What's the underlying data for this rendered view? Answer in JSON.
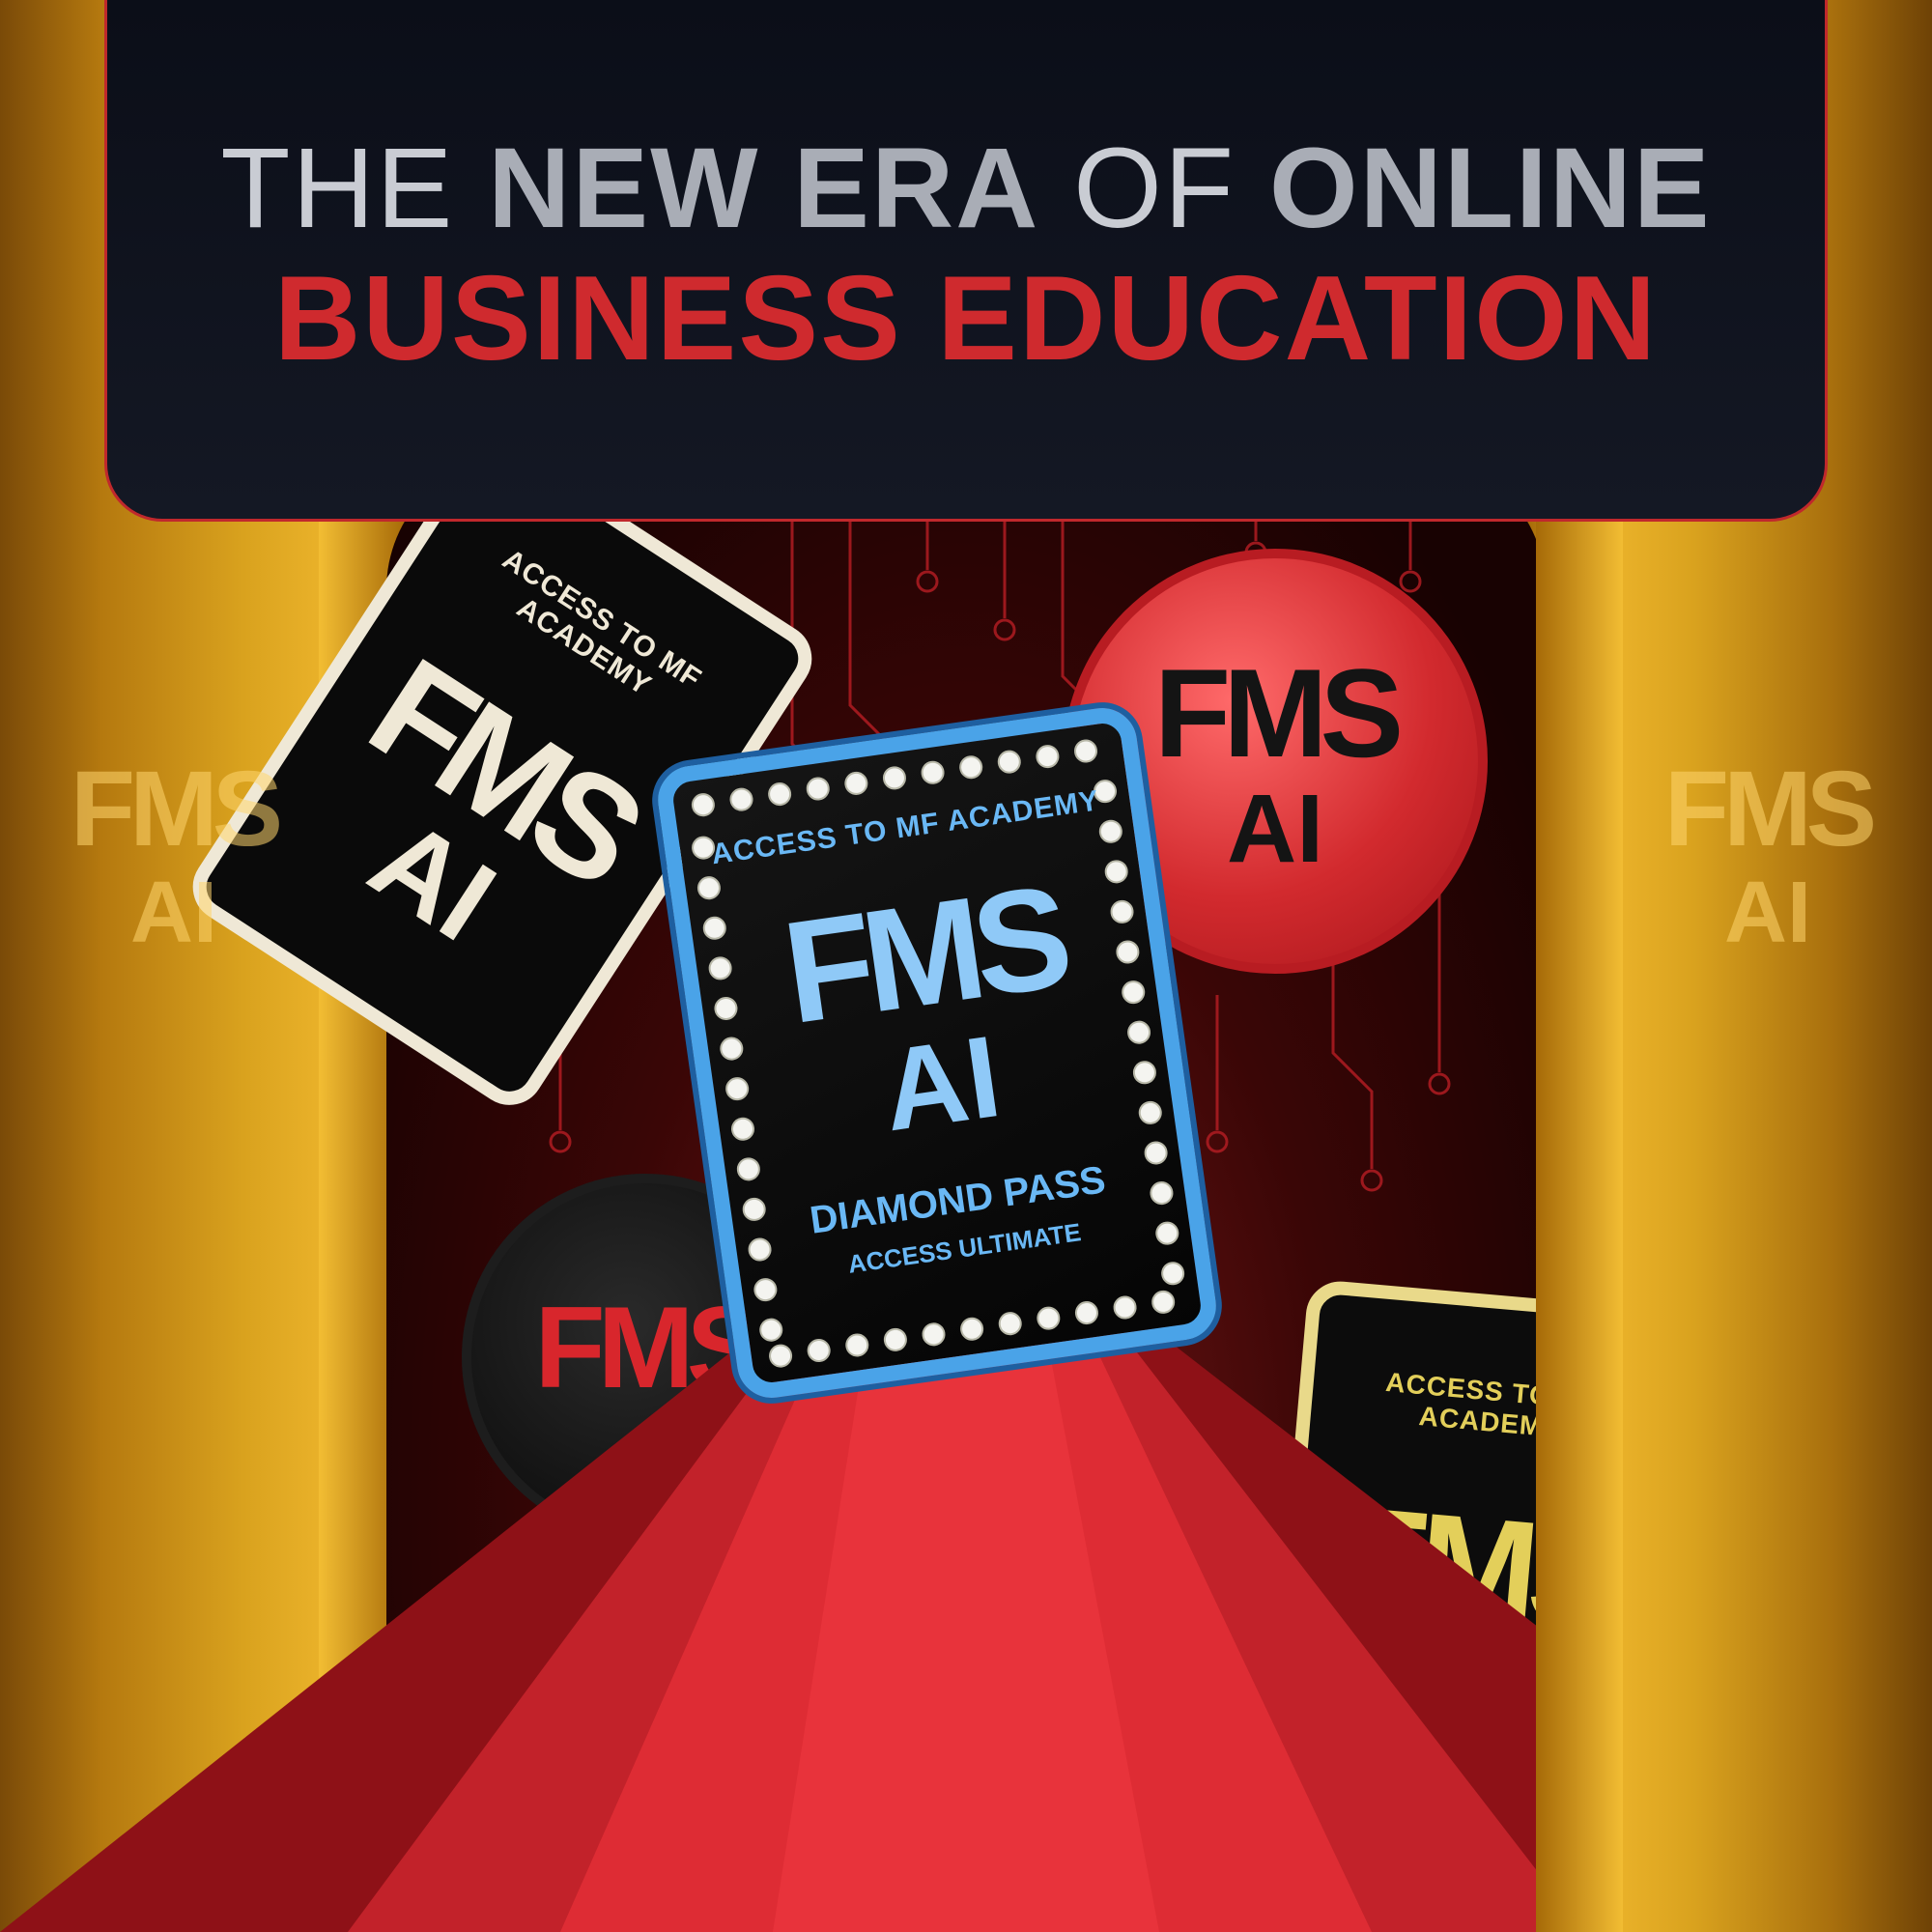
{
  "headline": {
    "line1_part1": "THE",
    "line1_part2": "NEW ERA",
    "line1_part3": "OF",
    "line1_part4": "ONLINE",
    "line2": "BUSINESS EDUCATION"
  },
  "logo": {
    "letters": "FMS",
    "ai": "AI"
  },
  "cards": {
    "diamond": {
      "top": "ACCESS TO MF ACADEMY",
      "pass": "DIAMOND PASS",
      "sub": "ACCESS ULTIMATE"
    },
    "back_left_top": "ACCESS TO MF ACADEMY",
    "back_right_top": "ACCESS TO MF ACADEMY"
  },
  "colors": {
    "banner_bg": "#0b0e18",
    "headline_gray": "#a9adb6",
    "headline_red": "#cf2a2e",
    "gold": "#e3a826",
    "carpet_red": "#d42630",
    "diamond_frame": "#4aa3e8"
  }
}
